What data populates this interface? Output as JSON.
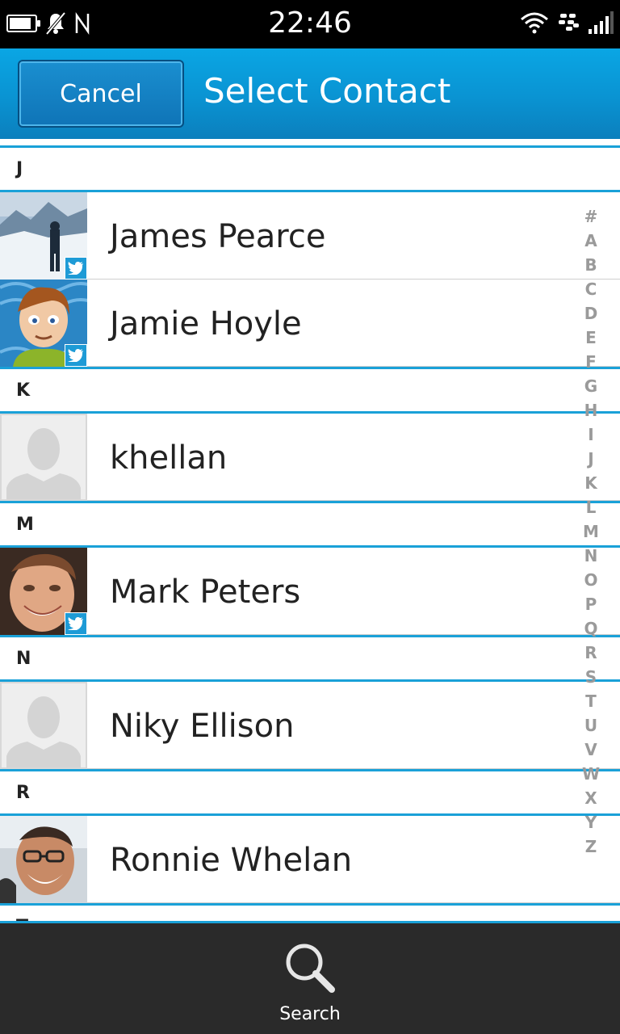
{
  "status_bar": {
    "time": "22:46",
    "icons": [
      "battery-icon",
      "notifications-muted-icon",
      "nfc-icon",
      "wifi-icon",
      "blackberry-icon",
      "signal-icon"
    ]
  },
  "header": {
    "cancel_label": "Cancel",
    "title": "Select Contact"
  },
  "sections": [
    {
      "letter": "J",
      "contacts": [
        {
          "name": "James Pearce",
          "avatar": "photo-mountain",
          "twitter": true
        },
        {
          "name": "Jamie Hoyle",
          "avatar": "cartoon-boy",
          "twitter": true
        }
      ]
    },
    {
      "letter": "K",
      "contacts": [
        {
          "name": "khellan",
          "avatar": "placeholder",
          "twitter": false
        }
      ]
    },
    {
      "letter": "M",
      "contacts": [
        {
          "name": "Mark Peters",
          "avatar": "photo-face",
          "twitter": true
        }
      ]
    },
    {
      "letter": "N",
      "contacts": [
        {
          "name": "Niky Ellison",
          "avatar": "placeholder",
          "twitter": false
        }
      ]
    },
    {
      "letter": "R",
      "contacts": [
        {
          "name": "Ronnie Whelan",
          "avatar": "photo-face-glasses",
          "twitter": false
        }
      ]
    },
    {
      "letter": "T",
      "contacts": []
    }
  ],
  "alphabet_index": [
    "#",
    "A",
    "B",
    "C",
    "D",
    "E",
    "F",
    "G",
    "H",
    "I",
    "J",
    "K",
    "L",
    "M",
    "N",
    "O",
    "P",
    "Q",
    "R",
    "S",
    "T",
    "U",
    "V",
    "W",
    "X",
    "Y",
    "Z"
  ],
  "bottom_bar": {
    "search_label": "Search"
  },
  "colors": {
    "accent": "#1aa1d8",
    "titlebar": "#0a93d2",
    "bottombar": "#2a2a2a"
  }
}
